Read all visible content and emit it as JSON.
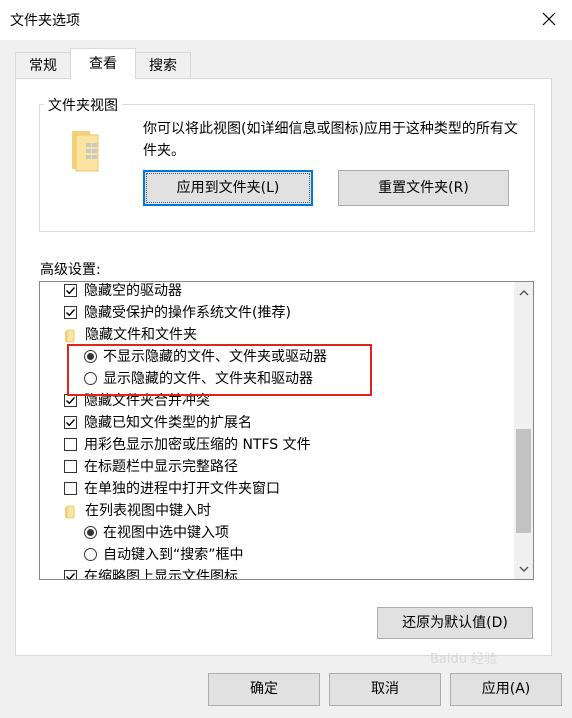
{
  "window": {
    "title": "文件夹选项"
  },
  "tabs": [
    {
      "label": "常规"
    },
    {
      "label": "查看"
    },
    {
      "label": "搜索"
    }
  ],
  "folder_views": {
    "legend": "文件夹视图",
    "description": "你可以将此视图(如详细信息或图标)应用于这种类型的所有文件夹。",
    "apply_button": "应用到文件夹(L)",
    "reset_button": "重置文件夹(R)"
  },
  "advanced": {
    "label": "高级设置:",
    "items": [
      {
        "type": "checkbox",
        "checked": true,
        "label": "隐藏空的驱动器"
      },
      {
        "type": "checkbox",
        "checked": true,
        "label": "隐藏受保护的操作系统文件(推荐)"
      },
      {
        "type": "folder",
        "label": "隐藏文件和文件夹"
      },
      {
        "type": "radio",
        "checked": true,
        "label": "不显示隐藏的文件、文件夹或驱动器"
      },
      {
        "type": "radio",
        "checked": false,
        "label": "显示隐藏的文件、文件夹和驱动器"
      },
      {
        "type": "checkbox",
        "checked": true,
        "label": "隐藏文件夹合并冲突"
      },
      {
        "type": "checkbox",
        "checked": true,
        "label": "隐藏已知文件类型的扩展名"
      },
      {
        "type": "checkbox",
        "checked": false,
        "label": "用彩色显示加密或压缩的 NTFS 文件"
      },
      {
        "type": "checkbox",
        "checked": false,
        "label": "在标题栏中显示完整路径"
      },
      {
        "type": "checkbox",
        "checked": false,
        "label": "在单独的进程中打开文件夹窗口"
      },
      {
        "type": "folder",
        "label": "在列表视图中键入时"
      },
      {
        "type": "radio",
        "checked": true,
        "label": "在视图中选中键入项"
      },
      {
        "type": "radio",
        "checked": false,
        "label": "自动键入到“搜索”框中"
      },
      {
        "type": "checkbox",
        "checked": true,
        "label": "在缩略图上显示文件图标"
      }
    ]
  },
  "restore_button": "还原为默认值(D)",
  "footer": {
    "ok": "确定",
    "cancel": "取消",
    "apply": "应用(A)"
  },
  "watermark": "Baidu 经验",
  "colors": {
    "accent": "#0078d7",
    "highlight": "#e2231a"
  }
}
